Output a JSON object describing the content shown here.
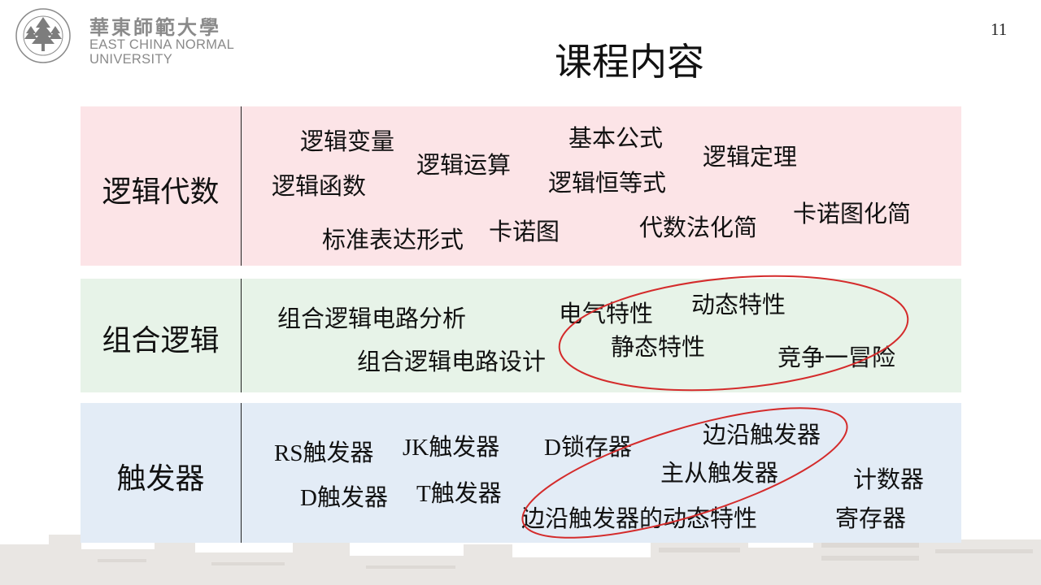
{
  "header": {
    "logo": {
      "cn_name": "華東師範大學",
      "en_line1": "EAST CHINA NORMAL",
      "en_line2": "UNIVERSITY"
    },
    "page_number": "11",
    "title": "课程内容"
  },
  "sections": [
    {
      "heading": "逻辑代数",
      "background": "#fce4e7",
      "terms": [
        "逻辑变量",
        "基本公式",
        "逻辑运算",
        "逻辑定理",
        "逻辑函数",
        "逻辑恒等式",
        "卡诺图化简",
        "代数法化简",
        "标准表达形式",
        "卡诺图"
      ]
    },
    {
      "heading": "组合逻辑",
      "background": "#e7f3e8",
      "terms": [
        "组合逻辑电路分析",
        "电气特性",
        "动态特性",
        "静态特性",
        "组合逻辑电路设计",
        "竞争一冒险"
      ]
    },
    {
      "heading": "触发器",
      "background": "#e3ecf6",
      "terms": [
        "边沿触发器",
        "RS触发器",
        "JK触发器",
        "D锁存器",
        "主从触发器",
        "计数器",
        "D触发器",
        "T触发器",
        "边沿触发器的动态特性",
        "寄存器"
      ]
    }
  ],
  "highlight_color": "#d42b2b"
}
